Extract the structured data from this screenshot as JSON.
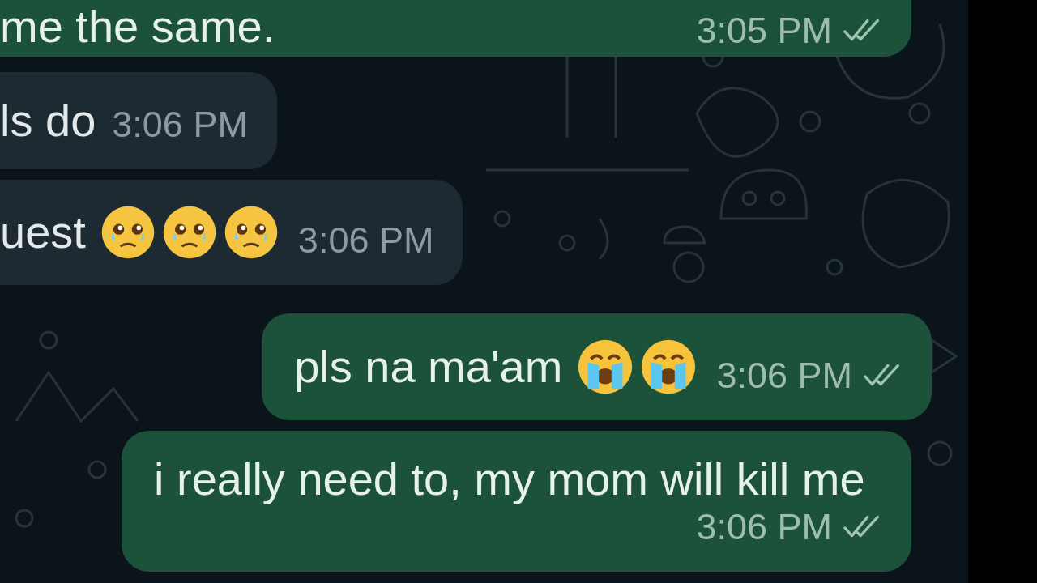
{
  "messages": [
    {
      "kind": "outgoing",
      "text": "me the same.",
      "time": "3:05 PM",
      "read": true
    },
    {
      "kind": "incoming",
      "text": "ls do",
      "time": "3:06 PM"
    },
    {
      "kind": "incoming",
      "text": "uest",
      "time": "3:06 PM",
      "emoji_icons": [
        {
          "kind": "teary"
        },
        {
          "kind": "teary"
        },
        {
          "kind": "teary"
        }
      ]
    },
    {
      "kind": "outgoing",
      "text": "pls na ma'am",
      "time": "3:06 PM",
      "read": true,
      "emoji_icons": [
        {
          "kind": "crying"
        },
        {
          "kind": "crying"
        }
      ]
    },
    {
      "kind": "outgoing",
      "text": "i really need to, my mom will kill me",
      "time": "3:06 PM",
      "read": true
    }
  ]
}
